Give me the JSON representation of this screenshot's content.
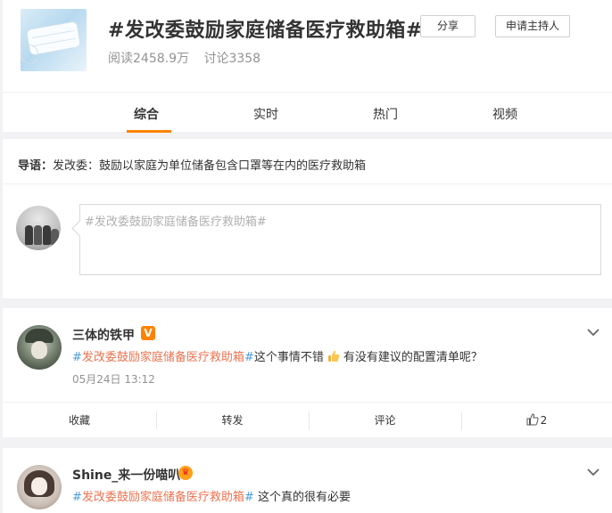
{
  "topic": {
    "title": "#发改委鼓励家庭储备医疗救助箱#",
    "reads": "阅读2458.9万",
    "discussions": "讨论3358",
    "share_label": "分享",
    "host_label": "申请主持人"
  },
  "tabs": [
    {
      "label": "综合",
      "active": true
    },
    {
      "label": "实时",
      "active": false
    },
    {
      "label": "热门",
      "active": false
    },
    {
      "label": "视频",
      "active": false
    }
  ],
  "intro": {
    "prefix": "导语：",
    "text": "发改委：鼓励以家庭为单位储备包含口罩等在内的医疗救助箱"
  },
  "compose": {
    "placeholder": "#发改委鼓励家庭储备医疗救助箱#"
  },
  "posts": [
    {
      "username": "三体的铁甲",
      "badge": "V",
      "hashtag_open": "#",
      "hashtag": "发改委鼓励家庭储备医疗救助箱",
      "hashtag_close": "#",
      "text_before_emoji": "这个事情不错",
      "emoji": "thumbs-up-emoji",
      "text_after_emoji": "有没有建议的配置清单呢？",
      "timestamp": "05月24日 13:12",
      "actions": {
        "favorite": "收藏",
        "repost": "转发",
        "comment": "评论",
        "likes": "2"
      }
    },
    {
      "username": "Shine_来一份喵叭",
      "badge": "crown",
      "hashtag_open": "#",
      "hashtag": "发改委鼓励家庭储备医疗救助箱",
      "hashtag_close": "#",
      "text": " 这个真的很有必要"
    }
  ],
  "colors": {
    "accent": "#ff8200",
    "hashtag": "#eb7350",
    "hashtag_sign": "#4e9cd9",
    "muted": "#939393"
  }
}
